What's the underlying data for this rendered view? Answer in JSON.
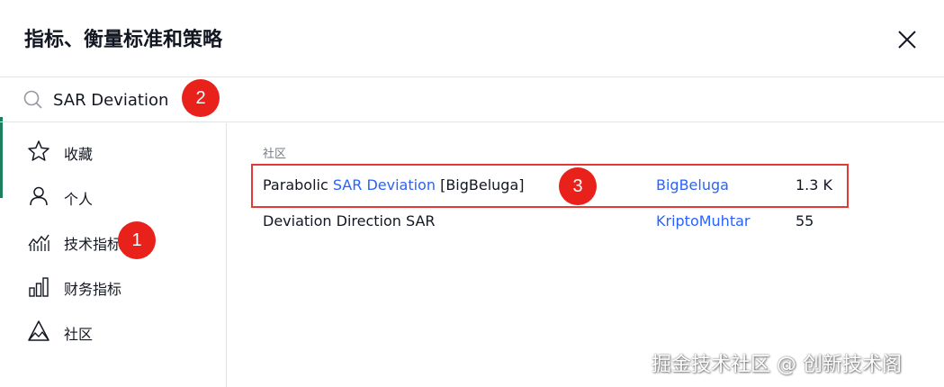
{
  "dialog": {
    "title": "指标、衡量标准和策略",
    "close_icon": "close-icon"
  },
  "search": {
    "value": "SAR Deviation",
    "icon": "search-icon"
  },
  "sidebar": {
    "items": [
      {
        "label": "收藏",
        "icon": "star-icon"
      },
      {
        "label": "个人",
        "icon": "user-icon"
      },
      {
        "label": "技术指标",
        "icon": "technical-chart-icon"
      },
      {
        "label": "财务指标",
        "icon": "bar-chart-icon"
      },
      {
        "label": "社区",
        "icon": "community-icon"
      }
    ]
  },
  "results": {
    "section_label": "社区",
    "rows": [
      {
        "name_prefix": "Parabolic ",
        "name_match": "SAR Deviation",
        "name_suffix": " [BigBeluga]",
        "author": "BigBeluga",
        "count": "1.3 K"
      },
      {
        "name_prefix": "Deviation Direction SAR",
        "name_match": "",
        "name_suffix": "",
        "author": "KriptoMuhtar",
        "count": "55"
      }
    ]
  },
  "annotations": {
    "badge1": "1",
    "badge2": "2",
    "badge3": "3",
    "highlight_color": "#e53935",
    "badge_color": "#e8221b"
  },
  "watermark": "掘金技术社区 @ 创新技术阁",
  "colors": {
    "accent_link": "#2962ff",
    "text": "#131722",
    "muted": "#787b86"
  }
}
